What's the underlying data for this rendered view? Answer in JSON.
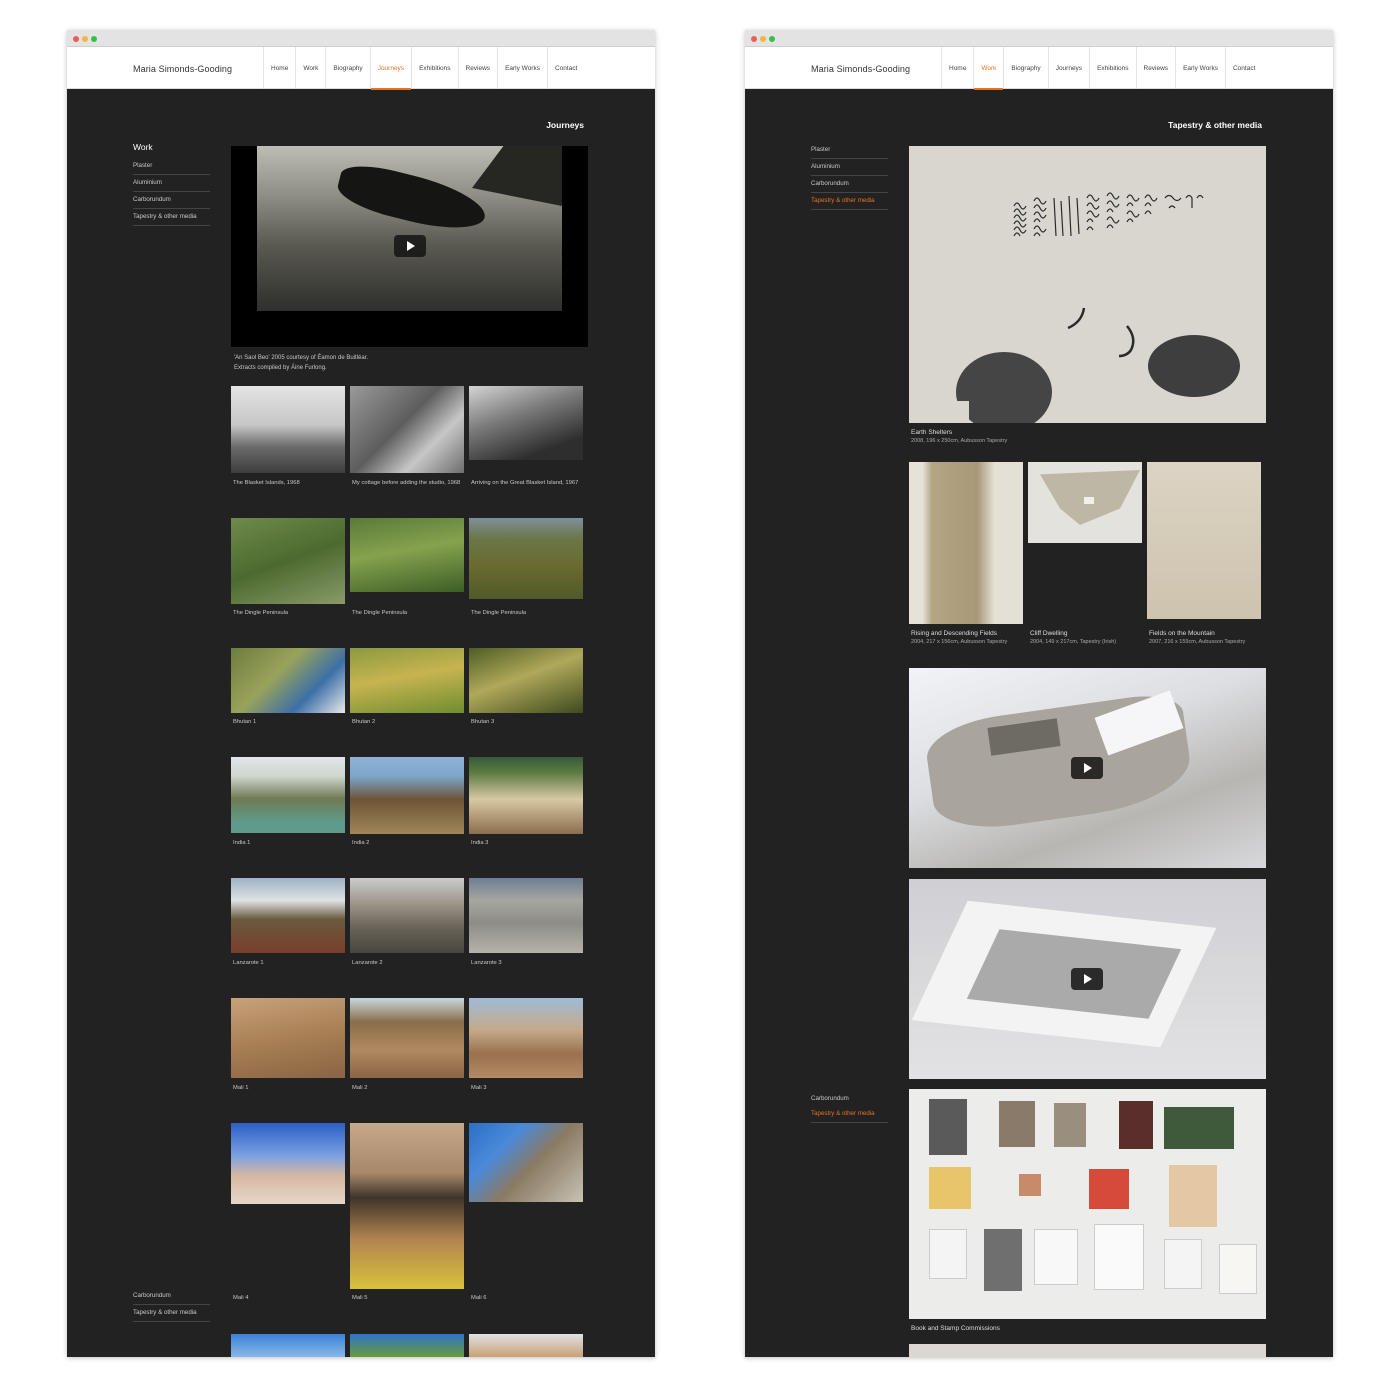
{
  "site_name": "Maria Simonds-Gooding",
  "nav": [
    "Home",
    "Work",
    "Biography",
    "Journeys",
    "Exhibitions",
    "Reviews",
    "Early Works",
    "Contact"
  ],
  "left_page": {
    "active_nav": "Journeys",
    "title": "Journeys",
    "sidebar_heading": "Work",
    "sidebar_items": [
      "Plaster",
      "Aluminium",
      "Carborundum",
      "Tapestry & other media"
    ],
    "sidebar_footer_items": [
      "Carborundum",
      "Tapestry & other media"
    ],
    "video_caption_line1": "'An Saol Beo' 2005 courtesy of Éamon de Buitléar.",
    "video_caption_line2": "Extracts compiled by Áine Furlong.",
    "gallery": [
      "The Blasket Islands, 1968",
      "My cottage before adding the studio, 1968",
      "Arriving on the Great Blasket Island, 1967",
      "The Dingle Peninsula",
      "The Dingle Peninsula",
      "The Dingle Peninsula",
      "Bhutan 1",
      "Bhutan 2",
      "Bhutan 3",
      "India 1",
      "India 2",
      "India 3",
      "Lanzarote 1",
      "Lanzarote 2",
      "Lanzarote 3",
      "Mali 1",
      "Mali 2",
      "Mali 3",
      "Mali 4",
      "Mali 5",
      "Mali 6"
    ]
  },
  "right_page": {
    "active_nav": "Work",
    "title": "Tapestry & other media",
    "sidebar_items": [
      "Plaster",
      "Aluminium",
      "Carborundum",
      "Tapestry & other media"
    ],
    "active_sidebar": "Tapestry & other media",
    "sidebar_repeat_items": [
      "Carborundum",
      "Tapestry & other media"
    ],
    "works": [
      {
        "title": "Earth Shelters",
        "details": "2008, 196 x 250cm, Aubusson Tapestry"
      },
      {
        "title": "Rising and Descending Fields",
        "details": "2004, 217 x 156cm, Aubusson Tapestry"
      },
      {
        "title": "Cliff Dwelling",
        "details": "2004, 149 x 217cm, Tapestry (Irish)"
      },
      {
        "title": "Fields on the Mountain",
        "details": "2007, 216 x 159cm, Aubusson Tapestry"
      },
      {
        "title": "Book and Stamp Commissions",
        "details": ""
      }
    ]
  },
  "colors": {
    "accent": "#e8731e",
    "page_bg": "#222222",
    "header_bg": "#ffffff"
  },
  "icons": [
    "play-icon"
  ]
}
